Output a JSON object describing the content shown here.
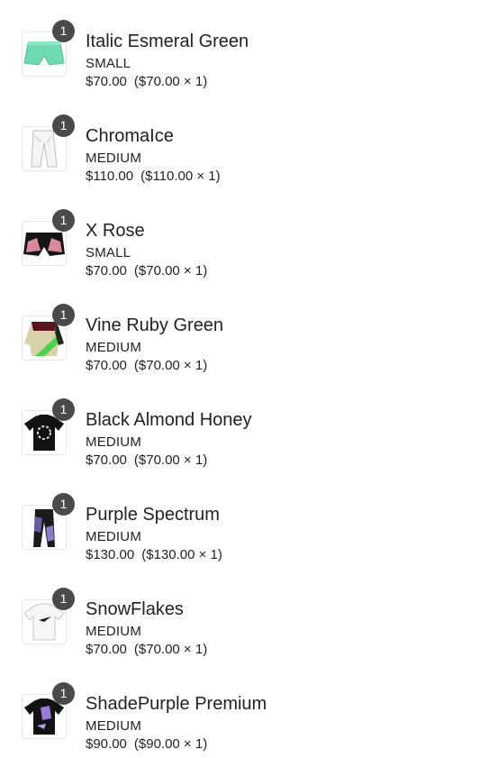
{
  "items": [
    {
      "name": "Italic Esmeral Green",
      "variant": "SMALL",
      "total": "$70.00",
      "unit": "($70.00 × 1)",
      "qty": "1",
      "thumb_icon": "mint-shorts-icon",
      "thumb_colors": [
        "#5fd6a9",
        "#7de2bb"
      ]
    },
    {
      "name": "ChromaIce",
      "variant": "MEDIUM",
      "total": "$110.00",
      "unit": "($110.00 × 1)",
      "qty": "1",
      "thumb_icon": "white-pants-icon",
      "thumb_colors": [
        "#f2f2f2",
        "#cfcfcf"
      ]
    },
    {
      "name": "X Rose",
      "variant": "SMALL",
      "total": "$70.00",
      "unit": "($70.00 × 1)",
      "qty": "1",
      "thumb_icon": "black-pink-shorts-icon",
      "thumb_colors": [
        "#111111",
        "#d88a9a"
      ]
    },
    {
      "name": "Vine Ruby Green",
      "variant": "MEDIUM",
      "total": "$70.00",
      "unit": "($70.00 × 1)",
      "qty": "1",
      "thumb_icon": "ruby-green-sweater-icon",
      "thumb_colors": [
        "#5a1420",
        "#d8d2a8",
        "#4cd24a",
        "#1b2a1b"
      ]
    },
    {
      "name": "Black Almond Honey",
      "variant": "MEDIUM",
      "total": "$70.00",
      "unit": "($70.00 × 1)",
      "qty": "1",
      "thumb_icon": "black-tee-icon",
      "thumb_colors": [
        "#111111",
        "#d9d9d9"
      ]
    },
    {
      "name": "Purple Spectrum",
      "variant": "MEDIUM",
      "total": "$130.00",
      "unit": "($130.00 × 1)",
      "qty": "1",
      "thumb_icon": "purple-pants-icon",
      "thumb_colors": [
        "#6a5aa8",
        "#1a1a1a"
      ]
    },
    {
      "name": "SnowFlakes",
      "variant": "MEDIUM",
      "total": "$70.00",
      "unit": "($70.00 × 1)",
      "qty": "1",
      "thumb_icon": "white-tee-icon",
      "thumb_colors": [
        "#f4f4f4",
        "#222222"
      ]
    },
    {
      "name": "ShadePurple Premium",
      "variant": "MEDIUM",
      "total": "$90.00",
      "unit": "($90.00 × 1)",
      "qty": "1",
      "thumb_icon": "black-purple-tee-icon",
      "thumb_colors": [
        "#111111",
        "#9a7ad8"
      ]
    }
  ]
}
